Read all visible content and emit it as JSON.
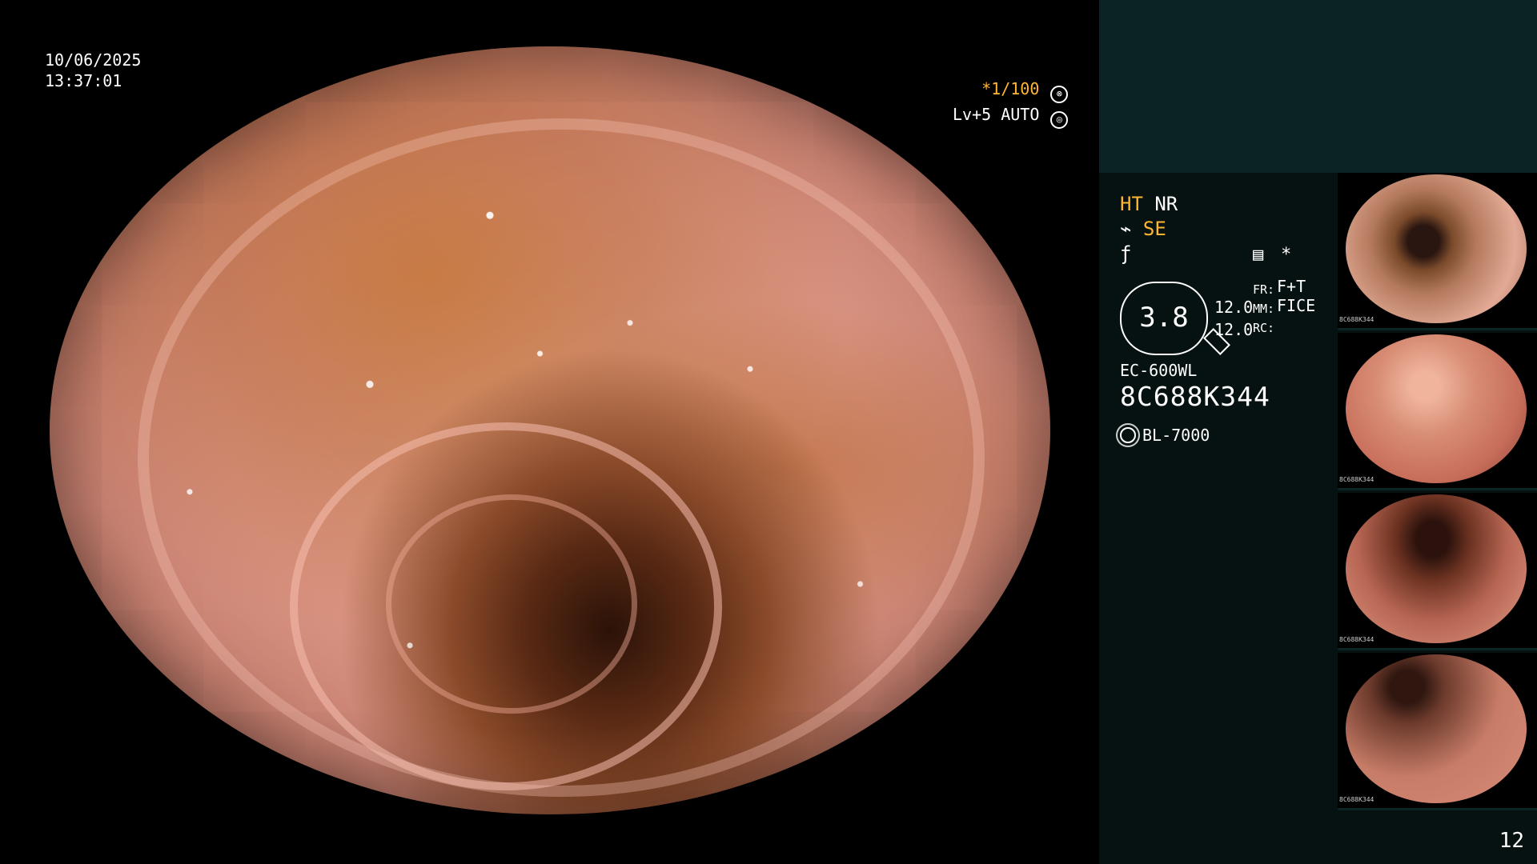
{
  "overlay": {
    "date": "10/06/2025",
    "time": "13:37:01",
    "shutter": "*1/100",
    "level": "Lv+5 AUTO"
  },
  "panel": {
    "ht": "HT",
    "nr": "NR",
    "se": "SE",
    "dial_value": "3.8",
    "dial_top": "12.0",
    "dial_bottom": "12.0",
    "fr_label": "FR:",
    "fr_value": "F+T",
    "mm_label": "MM:",
    "mm_value": "FICE",
    "rc_label": "RC:",
    "model": "EC-600WL",
    "serial": "8C688K344",
    "light_source": "BL-7000",
    "page_number": "12"
  },
  "thumbnails": [
    {
      "caption": "8C688K344"
    },
    {
      "caption": "8C688K344"
    },
    {
      "caption": "8C688K344"
    },
    {
      "caption": "8C688K344"
    }
  ],
  "colors": {
    "accent_orange": "#ffb733",
    "panel_background": "#061212",
    "panel_header": "#0b2324"
  },
  "icons": [
    "shutter-icon",
    "auto-icon",
    "filter-icon",
    "record-icon",
    "light-icon"
  ]
}
